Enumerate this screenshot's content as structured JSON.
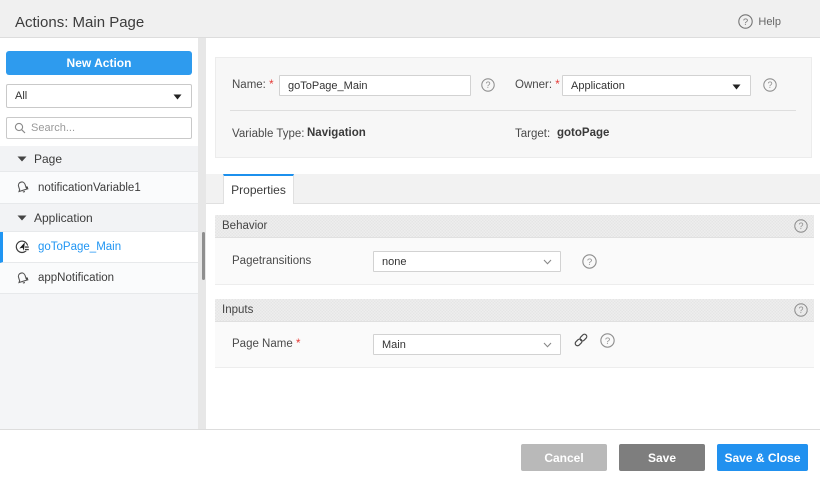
{
  "header": {
    "title": "Actions: Main Page",
    "help_label": "Help"
  },
  "sidebar": {
    "new_action_label": "New Action",
    "filter_value": "All",
    "search_placeholder": "Search...",
    "tree": [
      {
        "type": "group",
        "label": "Page",
        "expanded": true
      },
      {
        "type": "item",
        "icon": "bell-icon",
        "label": "notificationVariable1",
        "selected": false
      },
      {
        "type": "group",
        "label": "Application",
        "expanded": true
      },
      {
        "type": "item",
        "icon": "navigate-page-icon",
        "label": "goToPage_Main",
        "selected": true
      },
      {
        "type": "item",
        "icon": "bell-icon",
        "label": "appNotification",
        "selected": false
      }
    ]
  },
  "form": {
    "name_label": "Name:",
    "name_required": "*",
    "name_value": "goToPage_Main",
    "owner_label": "Owner:",
    "owner_required": "*",
    "owner_value": "Application",
    "variable_type_label": "Variable Type:",
    "variable_type_value": "Navigation",
    "target_label": "Target:",
    "target_value": "gotoPage"
  },
  "tabs": [
    {
      "label": "Properties",
      "active": true
    }
  ],
  "sections": [
    {
      "title": "Behavior",
      "rows": [
        {
          "label": "Pagetransitions",
          "required": "",
          "value": "none",
          "has_link": false,
          "has_help": true
        }
      ]
    },
    {
      "title": "Inputs",
      "rows": [
        {
          "label": "Page Name",
          "required": "*",
          "value": "Main",
          "has_link": true,
          "has_help": true
        }
      ]
    }
  ],
  "footer": {
    "cancel_label": "Cancel",
    "save_label": "Save",
    "save_close_label": "Save & Close"
  },
  "colors": {
    "primary_blue": "#2196f3",
    "header_bg": "#f0f0f0",
    "selected_text": "#2196f3",
    "cancel_gray": "#b9b9b9",
    "save_gray": "#7e7e7e"
  }
}
